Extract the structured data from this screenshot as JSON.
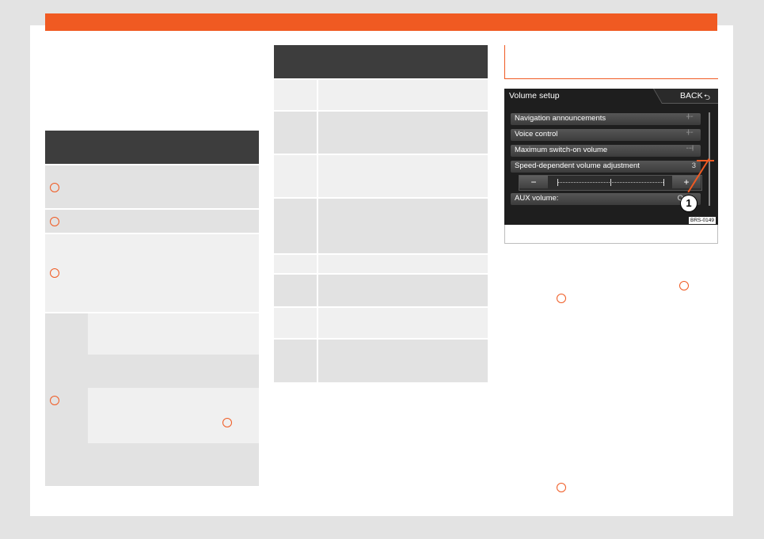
{
  "accent_color": "#f05a22",
  "header_bar_color": "#3d3d3d",
  "figure": {
    "screen_title": "Volume setup",
    "back_label": "BACK",
    "back_icon": "return-arrow-icon",
    "menu_items": [
      {
        "label": "Navigation announcements",
        "indicator": "··|····"
      },
      {
        "label": "Voice control",
        "indicator": "··|····"
      },
      {
        "label": "Maximum switch-on volume",
        "indicator": "······|"
      },
      {
        "label": "Speed-dependent volume adjustment",
        "value": "3"
      }
    ],
    "slider": {
      "minus": "−",
      "plus": "+"
    },
    "aux_row": {
      "label": "AUX volume:",
      "value": "Q"
    },
    "callout_number": "1",
    "image_code": "BRS-0149"
  }
}
